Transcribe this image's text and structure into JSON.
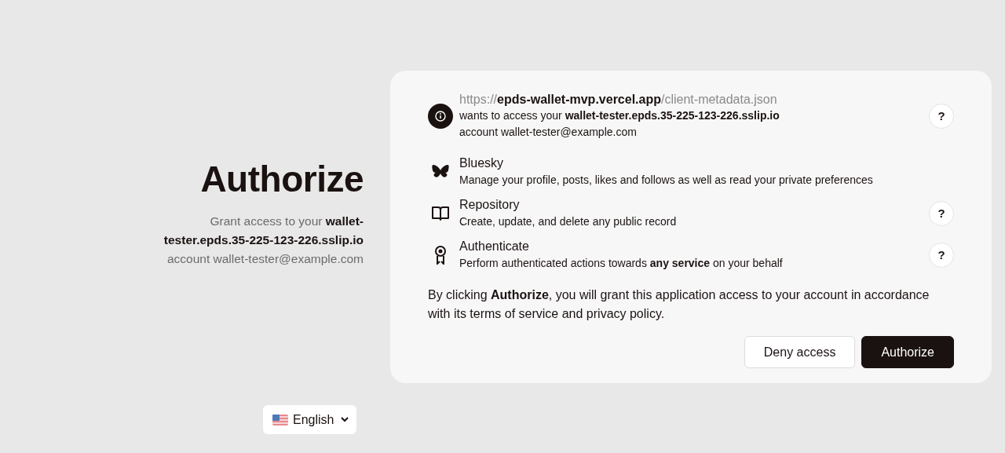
{
  "heading": {
    "title": "Authorize",
    "description": "Grant access to your **wallet-tester.epds.35-225-123-226.sslip.io**",
    "account": "account wallet-tester@example.com"
  },
  "client": {
    "url": "https://**epds-wallet-mvp.vercel.app**/client-metadata.json",
    "access": "wants to access your **wallet-tester.epds.35-225-123-226.sslip.io**",
    "account": "account wallet-tester@example.com",
    "help": "?"
  },
  "permissions": [
    {
      "kind": "butterfly",
      "title": "Bluesky",
      "description": "Manage your profile, posts, likes and follows as well as read your private preferences"
    },
    {
      "kind": "book",
      "title": "Repository",
      "description": "Create, update, and delete any public record",
      "help": "?"
    },
    {
      "kind": "badge",
      "title": "Authenticate",
      "description": "Perform authenticated actions towards **any service** on your behalf",
      "help": "?"
    }
  ],
  "notice": "By clicking **Authorize**, you will grant this application access to your account in accordance with its terms of service and privacy policy.",
  "buttons": {
    "deny": "Deny access",
    "authorize": "Authorize"
  },
  "language": {
    "value": "English"
  }
}
